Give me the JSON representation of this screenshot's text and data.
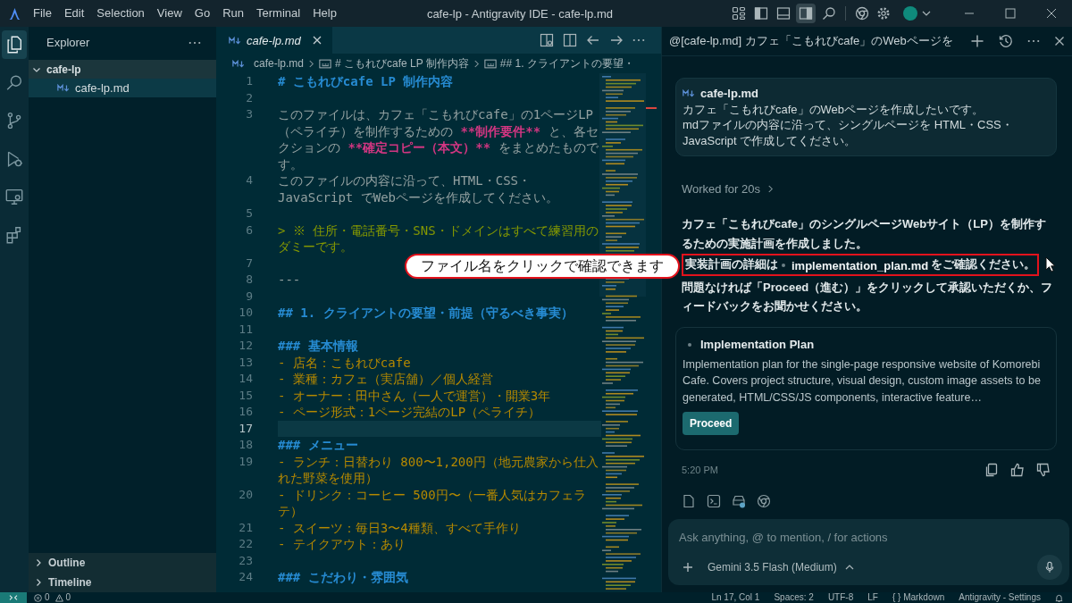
{
  "window": {
    "title": "cafe-lp - Antigravity IDE - cafe-lp.md",
    "menu": [
      "File",
      "Edit",
      "Selection",
      "View",
      "Go",
      "Run",
      "Terminal",
      "Help"
    ],
    "layout_toggles": [
      {
        "kind": "customize_layout",
        "selected": false
      },
      {
        "kind": "primary_sidebar",
        "selected": false
      },
      {
        "kind": "panel",
        "selected": false
      },
      {
        "kind": "secondary_sidebar",
        "selected": true
      }
    ]
  },
  "activity_bar": [
    {
      "kind": "explorer",
      "selected": true
    },
    {
      "kind": "search",
      "selected": false
    },
    {
      "kind": "source_control",
      "selected": false
    },
    {
      "kind": "run_debug",
      "selected": false
    },
    {
      "kind": "remote",
      "selected": false
    },
    {
      "kind": "extensions",
      "selected": false
    }
  ],
  "sidebar": {
    "title": "Explorer",
    "tree": [
      {
        "label": "cafe-lp",
        "expanded": true,
        "children": [
          {
            "label": "cafe-lp.md",
            "selected": true
          }
        ]
      }
    ],
    "sections": [
      {
        "label": "Outline",
        "expanded": false
      },
      {
        "label": "Timeline",
        "expanded": false
      }
    ]
  },
  "editor": {
    "tab": {
      "label": "cafe-lp.md",
      "preview": true
    },
    "breadcrumbs": [
      {
        "kind": "file",
        "label": "cafe-lp.md"
      },
      {
        "kind": "symbol",
        "label": "# こもれびcafe LP 制作内容"
      },
      {
        "kind": "symbol",
        "label": "## 1. クライアントの要望・"
      }
    ],
    "lines": [
      {
        "number": "1",
        "kind": "heading",
        "current": false,
        "segments": [
          {
            "kind": "plain",
            "text": "# こもれびcafe LP 制作内容"
          }
        ]
      },
      {
        "number": "2",
        "kind": "blank",
        "current": false
      },
      {
        "number": "3",
        "kind": "plain",
        "current": false,
        "segments": [
          {
            "kind": "plain",
            "text": "このファイルは、カフェ「こもれびcafe」の1ページLP（ペライチ）を制作するための "
          },
          {
            "kind": "strong",
            "text": "**制作要件**"
          },
          {
            "kind": "plain",
            "text": " と、各セクションの "
          },
          {
            "kind": "strong",
            "text": "**確定コピー（本文）**"
          },
          {
            "kind": "plain",
            "text": " をまとめたものです。"
          }
        ]
      },
      {
        "number": "4",
        "kind": "plain",
        "current": false,
        "segments": [
          {
            "kind": "plain",
            "text": "このファイルの内容に沿って、HTML・CSS・JavaScript でWebページを作成してください。"
          }
        ]
      },
      {
        "number": "5",
        "kind": "blank",
        "current": false
      },
      {
        "number": "6",
        "kind": "quote",
        "current": false,
        "segments": [
          {
            "kind": "plain",
            "text": "> ※ 住所・電話番号・SNS・ドメインはすべて練習用のダミーです。"
          }
        ]
      },
      {
        "number": "7",
        "kind": "blank",
        "current": false
      },
      {
        "number": "8",
        "kind": "rule",
        "current": false,
        "segments": [
          {
            "kind": "plain",
            "text": "---"
          }
        ]
      },
      {
        "number": "9",
        "kind": "blank",
        "current": false
      },
      {
        "number": "10",
        "kind": "heading",
        "current": false,
        "segments": [
          {
            "kind": "plain",
            "text": "## 1. クライアントの要望・前提（守るべき事実）"
          }
        ]
      },
      {
        "number": "11",
        "kind": "blank",
        "current": false
      },
      {
        "number": "12",
        "kind": "heading",
        "current": false,
        "segments": [
          {
            "kind": "plain",
            "text": "### 基本情報"
          }
        ]
      },
      {
        "number": "13",
        "kind": "list",
        "current": false,
        "segments": [
          {
            "kind": "plain",
            "text": "- 店名：こもれびcafe"
          }
        ]
      },
      {
        "number": "14",
        "kind": "list",
        "current": false,
        "segments": [
          {
            "kind": "plain",
            "text": "- 業種：カフェ（実店舗）／個人経営"
          }
        ]
      },
      {
        "number": "15",
        "kind": "list",
        "current": false,
        "segments": [
          {
            "kind": "plain",
            "text": "- オーナー：田中さん（一人で運営）・開業3年"
          }
        ]
      },
      {
        "number": "16",
        "kind": "list",
        "current": false,
        "segments": [
          {
            "kind": "plain",
            "text": "- ページ形式：1ページ完結のLP（ペライチ）"
          }
        ]
      },
      {
        "number": "17",
        "kind": "blank",
        "current": true
      },
      {
        "number": "18",
        "kind": "heading",
        "current": false,
        "segments": [
          {
            "kind": "plain",
            "text": "### メニュー"
          }
        ]
      },
      {
        "number": "19",
        "kind": "list",
        "current": false,
        "segments": [
          {
            "kind": "plain",
            "text": "- ランチ：日替わり 800〜1,200円（地元農家から仕入れた野菜を使用）"
          }
        ]
      },
      {
        "number": "20",
        "kind": "list",
        "current": false,
        "segments": [
          {
            "kind": "plain",
            "text": "- ドリンク：コーヒー 500円〜（一番人気はカフェラテ）"
          }
        ]
      },
      {
        "number": "21",
        "kind": "list",
        "current": false,
        "segments": [
          {
            "kind": "plain",
            "text": "- スイーツ：毎日3〜4種類、すべて手作り"
          }
        ]
      },
      {
        "number": "22",
        "kind": "list",
        "current": false,
        "segments": [
          {
            "kind": "plain",
            "text": "- テイクアウト：あり"
          }
        ]
      },
      {
        "number": "23",
        "kind": "blank",
        "current": false
      },
      {
        "number": "24",
        "kind": "heading",
        "current": false,
        "segments": [
          {
            "kind": "plain",
            "text": "### こだわり・雰囲気"
          }
        ]
      }
    ]
  },
  "chat": {
    "title": "@[cafe-lp.md] カフェ「こもれびcafe」のWebページを",
    "user_message": {
      "attachment": "cafe-lp.md",
      "lines": [
        "カフェ「こもれびcafe」のWebページを作成したいです。",
        "mdファイルの内容に沿って、シングルページを HTML・CSS・JavaScript で作成してください。"
      ]
    },
    "worked_for": "Worked for 20s",
    "reply": {
      "summary": "カフェ「こもれびcafe」のシングルページWebサイト（LP）を制作するための実施計画を作成しました。",
      "detail": {
        "before": "実装計画の詳細は",
        "file_link": "implementation_plan.md",
        "after": "をご確認ください。",
        "rest": "問題なければ「Proceed（進む）」をクリックして承認いただくか、フィードバックをお聞かせください。",
        "highlighted": true
      }
    },
    "annotation": {
      "text": "ファイル名をクリックで確認できます"
    },
    "artifact": {
      "title": "Implementation Plan",
      "description": "Implementation plan for the single-page responsive website of Komorebi Cafe. Covers project structure, visual design, custom image assets to be generated, HTML/CSS/JS components, interactive feature…",
      "button": "Proceed"
    },
    "time": "5:20 PM",
    "input": {
      "placeholder": "Ask anything, @ to mention, / for actions",
      "model": "Gemini 3.5 Flash (Medium)"
    }
  },
  "status_bar": {
    "errors": "0",
    "warnings": "0",
    "items": [
      "Ln 17, Col 1",
      "Spaces: 2",
      "UTF-8",
      "LF",
      "{ } Markdown",
      "Antigravity - Settings"
    ]
  }
}
